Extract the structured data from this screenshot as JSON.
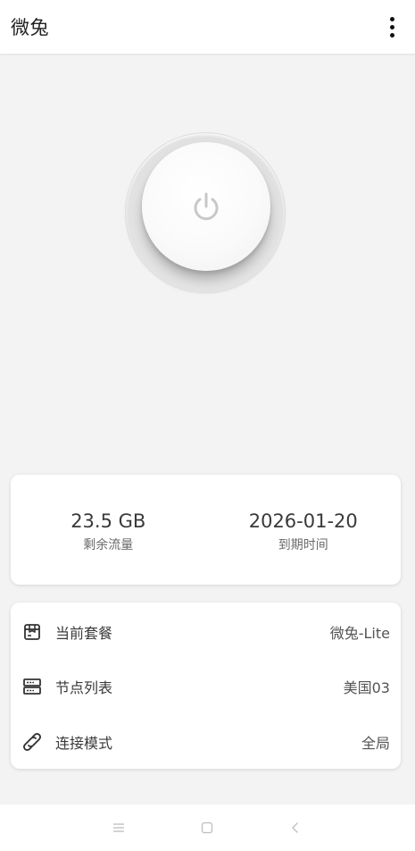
{
  "app": {
    "title": "微兔"
  },
  "stats": {
    "traffic_value": "23.5 GB",
    "traffic_label": "剩余流量",
    "expiry_value": "2026-01-20",
    "expiry_label": "到期时间"
  },
  "info": {
    "rows": [
      {
        "label": "当前套餐",
        "value": "微兔-Lite",
        "icon": "package-icon"
      },
      {
        "label": "节点列表",
        "value": "美国03",
        "icon": "server-icon"
      },
      {
        "label": "连接模式",
        "value": "全局",
        "icon": "link-icon"
      }
    ]
  },
  "colors": {
    "background": "#f3f3f3",
    "card": "#ffffff",
    "text_primary": "#3a3a3a",
    "icon_gray": "#bdbdbd"
  },
  "navbar": {
    "items": [
      "menu-icon",
      "home-icon",
      "back-icon"
    ]
  }
}
